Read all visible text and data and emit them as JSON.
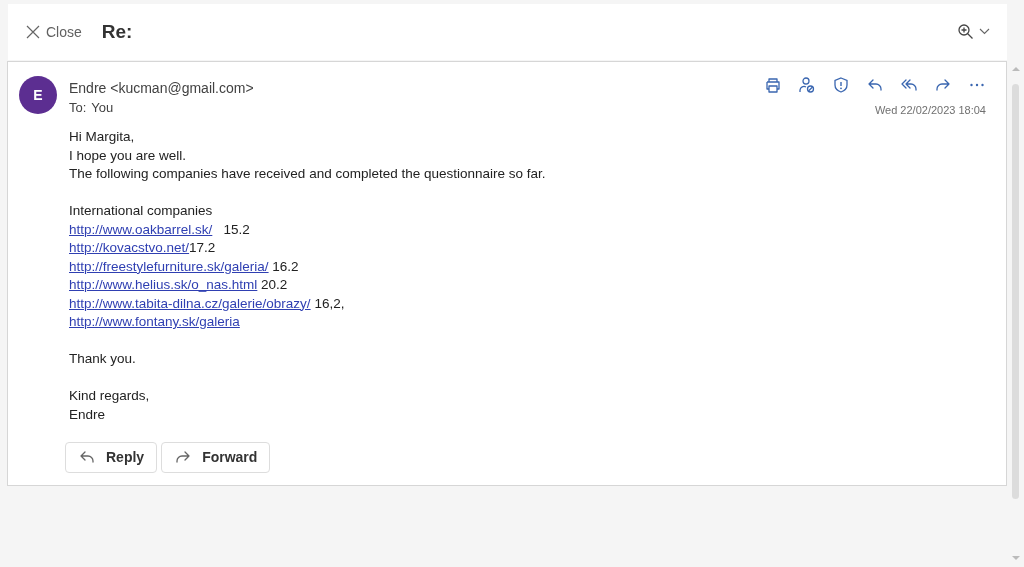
{
  "header": {
    "close_label": "Close",
    "subject": "Re:"
  },
  "message": {
    "avatar_initial": "E",
    "sender": "Endre <kucman@gmail.com>",
    "to_label": "To:",
    "to_value": "You",
    "date": "Wed 22/02/2023 18:04",
    "toolbar": [
      {
        "kind": "print"
      },
      {
        "kind": "person-block"
      },
      {
        "kind": "shield"
      },
      {
        "kind": "reply"
      },
      {
        "kind": "reply-all"
      },
      {
        "kind": "forward"
      },
      {
        "kind": "more"
      }
    ],
    "paragraphs": [
      {
        "lines": [
          {
            "kind": "text",
            "text": "Hi Margita,"
          },
          {
            "kind": "text",
            "text": "I hope you are well."
          },
          {
            "kind": "text",
            "text": "The following companies have received and completed the questionnaire so far."
          }
        ]
      },
      {
        "lines": [
          {
            "kind": "text",
            "text": "International companies"
          },
          {
            "kind": "link",
            "link": "http://www.oakbarrel.sk/",
            "after": "   15.2"
          },
          {
            "kind": "link",
            "link": "http://kovacstvo.net/",
            "after": "17.2"
          },
          {
            "kind": "link",
            "link": "http://freestylefurniture.sk/galeria/",
            "after": " 16.2"
          },
          {
            "kind": "link",
            "link": "http://www.helius.sk/o_nas.html",
            "after": " 20.2"
          },
          {
            "kind": "link",
            "link": "http://www.tabita-dilna.cz/galerie/obrazy/",
            "after": " 16,2,"
          },
          {
            "kind": "link",
            "link": "http://www.fontany.sk/galeria"
          }
        ]
      },
      {
        "lines": [
          {
            "kind": "text",
            "text": "Thank you."
          }
        ]
      },
      {
        "lines": [
          {
            "kind": "text",
            "text": "Kind regards,"
          },
          {
            "kind": "text",
            "text": "Endre"
          }
        ]
      }
    ],
    "actions": [
      {
        "kind": "reply",
        "label": "Reply"
      },
      {
        "kind": "forward",
        "label": "Forward"
      }
    ]
  }
}
